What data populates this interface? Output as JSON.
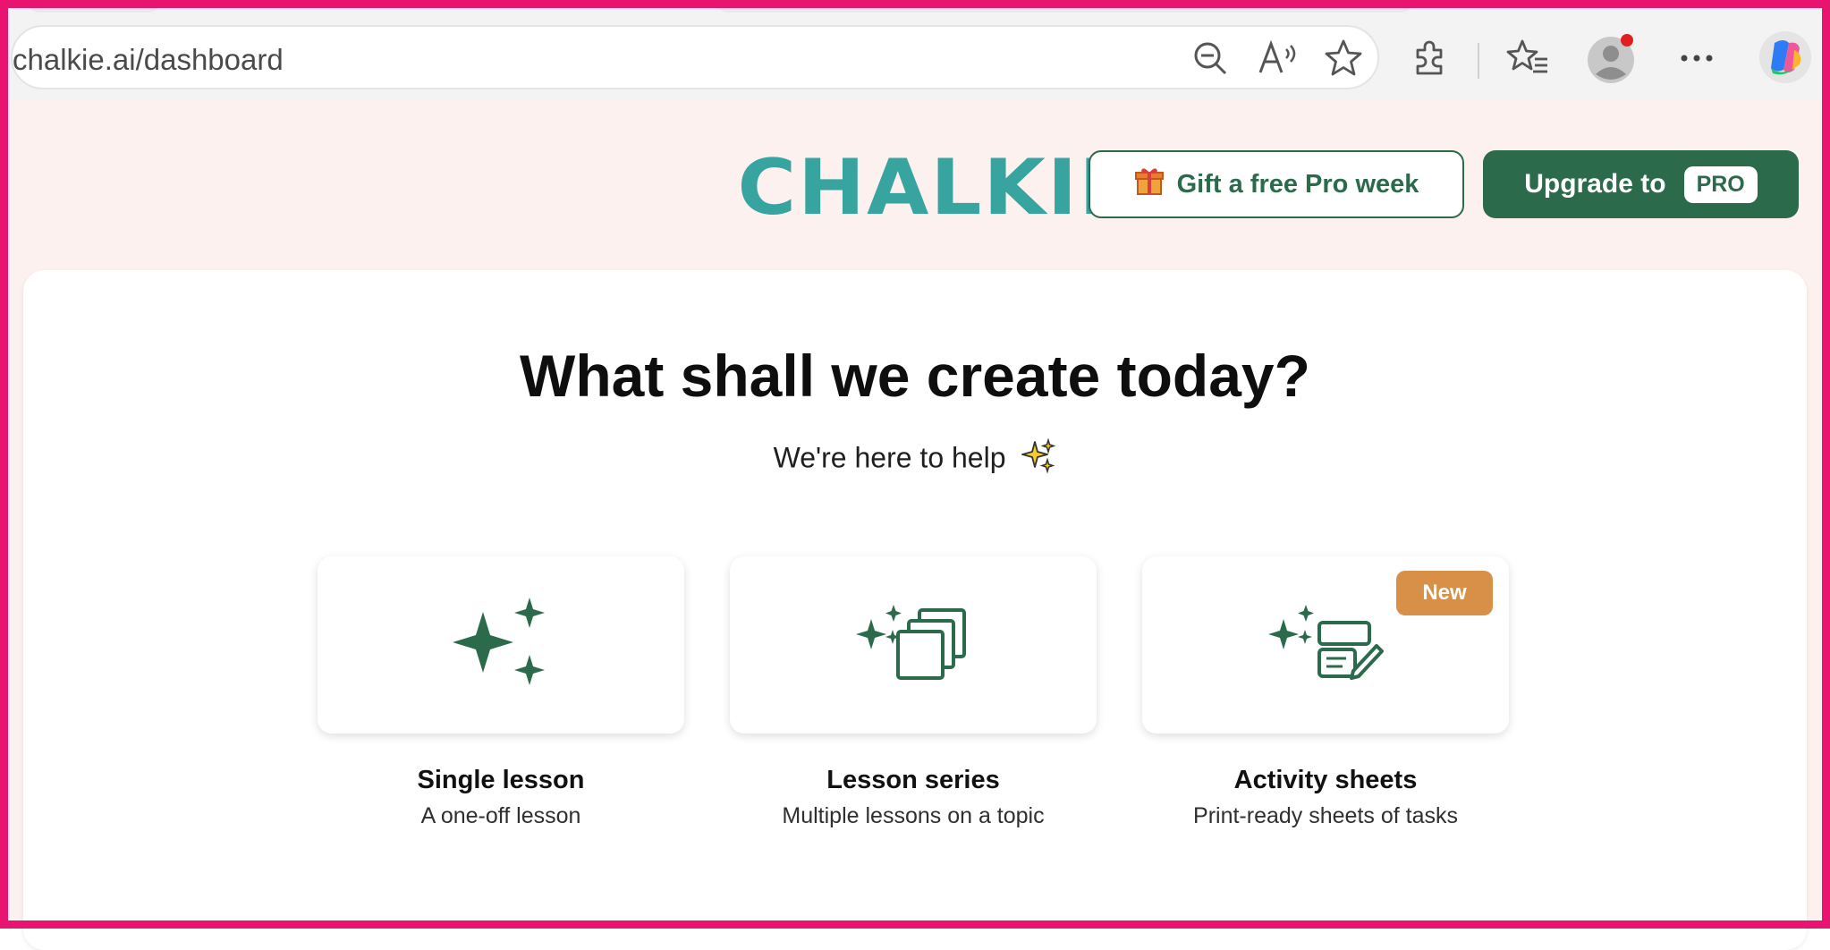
{
  "browser": {
    "url": "chalkie.ai/dashboard",
    "icons": [
      "zoom-out-icon",
      "read-aloud-icon",
      "favorite-star-icon",
      "extensions-icon",
      "favorites-list-icon",
      "profile-avatar-icon",
      "more-icon",
      "copilot-icon"
    ]
  },
  "header": {
    "logo_text": "CHALKIE",
    "gift_label": "Gift a free Pro week",
    "upgrade_label": "Upgrade to",
    "pro_badge": "PRO"
  },
  "main": {
    "title": "What shall we create today?",
    "subtitle": "We're here to help",
    "options": [
      {
        "title": "Single lesson",
        "description": "A one-off lesson",
        "icon": "sparkles-icon"
      },
      {
        "title": "Lesson series",
        "description": "Multiple lessons on a topic",
        "icon": "stacked-pages-icon",
        "badge": ""
      },
      {
        "title": "Activity sheets",
        "description": "Print-ready sheets of tasks",
        "icon": "activity-sheet-icon",
        "badge": "New"
      }
    ]
  },
  "colors": {
    "accent_green": "#2b6a4b",
    "logo_teal": "#37a4a0",
    "badge_orange": "#d89048",
    "page_background": "#fcf1ee",
    "frame": "#e8146f"
  }
}
